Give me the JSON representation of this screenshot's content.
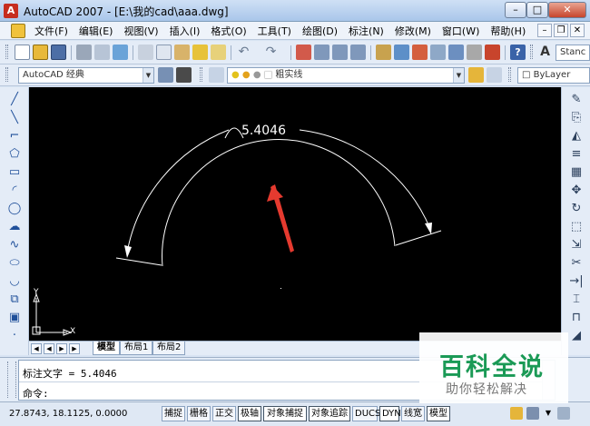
{
  "window": {
    "title": "AutoCAD 2007 - [E:\\我的cad\\aaa.dwg]"
  },
  "menu": {
    "items": [
      "文件(F)",
      "编辑(E)",
      "视图(V)",
      "插入(I)",
      "格式(O)",
      "工具(T)",
      "绘图(D)",
      "标注(N)",
      "修改(M)",
      "窗口(W)",
      "帮助(H)"
    ]
  },
  "toolbar": {
    "style_combo": "Stanc",
    "workspace_combo": "AutoCAD 经典",
    "layer_combo": "粗实线",
    "linetype_combo": "ByLayer"
  },
  "drawing": {
    "dimension_text": "5.4046",
    "ucs_x": "X",
    "ucs_y": "Y",
    "colors": {
      "background": "#000000",
      "lines": "#ffffff",
      "arrow": "#e53a2f"
    }
  },
  "tabs": [
    "模型",
    "布局1",
    "布局2"
  ],
  "command": {
    "line1": "标注文字 = 5.4046",
    "line2": "命令:"
  },
  "status": {
    "coords": "27.8743, 18.1125, 0.0000",
    "buttons": [
      "捕捉",
      "栅格",
      "正交",
      "极轴",
      "对象捕捉",
      "对象追踪",
      "DUCS",
      "DYN",
      "线宽",
      "模型"
    ]
  },
  "watermark": {
    "title": "百科全说",
    "subtitle": "助你轻松解决"
  },
  "icons": {
    "left": [
      "line-icon",
      "construction-line-icon",
      "polyline-icon",
      "polygon-icon",
      "rectangle-icon",
      "arc-icon",
      "circle-icon",
      "revision-cloud-icon",
      "spline-icon",
      "ellipse-icon",
      "ellipse-arc-icon",
      "insert-block-icon",
      "make-block-icon",
      "point-icon"
    ],
    "right": [
      "erase-icon",
      "copy-icon",
      "mirror-icon",
      "offset-icon",
      "array-icon",
      "move-icon",
      "rotate-icon",
      "scale-icon",
      "stretch-icon",
      "trim-icon",
      "extend-icon",
      "break-icon",
      "join-icon",
      "chamfer-icon"
    ]
  }
}
